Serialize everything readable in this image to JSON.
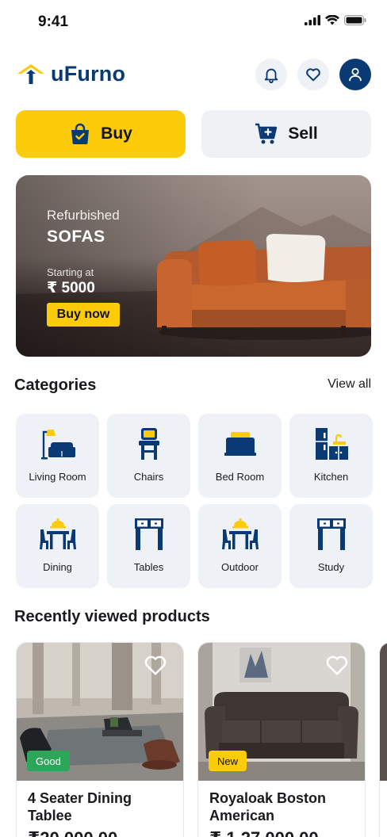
{
  "status_bar": {
    "time": "9:41"
  },
  "header": {
    "logo_text": "uFurno"
  },
  "mode": {
    "buy_label": "Buy",
    "sell_label": "Sell"
  },
  "banner": {
    "subtitle": "Refurbished",
    "title": "SOFAS",
    "starting_label": "Starting at",
    "price": "₹ 5000",
    "cta": "Buy now"
  },
  "categories": {
    "title": "Categories",
    "view_all": "View all",
    "items": [
      {
        "label": "Living Room",
        "icon": "living-room-icon"
      },
      {
        "label": "Chairs",
        "icon": "chair-icon"
      },
      {
        "label": "Bed Room",
        "icon": "bed-icon"
      },
      {
        "label": "Kitchen",
        "icon": "kitchen-icon"
      },
      {
        "label": "Dining",
        "icon": "dining-icon"
      },
      {
        "label": "Tables",
        "icon": "table-icon"
      },
      {
        "label": "Outdoor",
        "icon": "outdoor-icon"
      },
      {
        "label": "Study",
        "icon": "study-desk-icon"
      }
    ]
  },
  "recent": {
    "title": "Recently viewed products",
    "products": [
      {
        "name": "4 Seater Dining Tablee",
        "condition": "Good",
        "price": "₹20,000.00"
      },
      {
        "name": "Royaloak Boston American",
        "condition": "New",
        "price": "₹ 1,27,000.00"
      }
    ]
  },
  "colors": {
    "brand_navy": "#0a3a73",
    "accent_yellow": "#fccc0a",
    "badge_good": "#2ea65a",
    "badge_new": "#fccc0a",
    "tile_bg": "#eef2f6"
  }
}
